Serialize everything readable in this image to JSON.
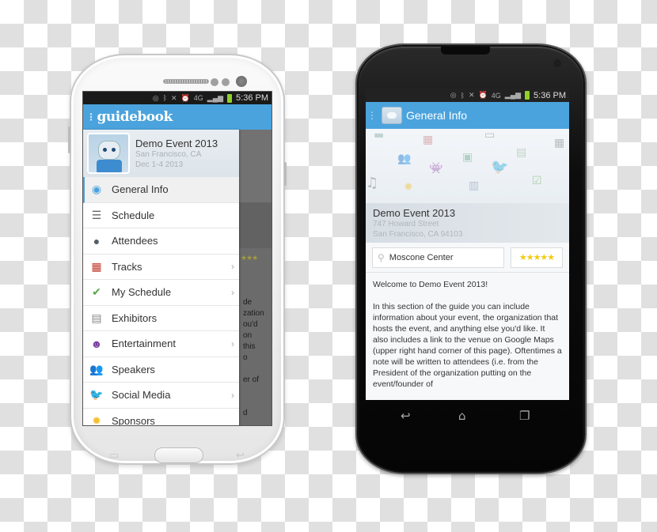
{
  "status_bar": {
    "time": "5:36 PM",
    "network": "4G"
  },
  "left_phone": {
    "app_bar": {
      "logo_text": "guidebook"
    },
    "drawer": {
      "event": {
        "title": "Demo Event 2013",
        "location": "San Francisco, CA",
        "dates": "Dec 1-4 2013"
      },
      "items": [
        {
          "label": "General Info",
          "icon": "eye-icon",
          "glyph": "◉",
          "color": "#4ba3dd",
          "chevron": false,
          "active": true
        },
        {
          "label": "Schedule",
          "icon": "schedule-list-icon",
          "glyph": "☰",
          "color": "#666666",
          "chevron": false,
          "active": false
        },
        {
          "label": "Attendees",
          "icon": "attendees-icon",
          "glyph": "●",
          "color": "#555e66",
          "chevron": false,
          "active": false
        },
        {
          "label": "Tracks",
          "icon": "calendar-icon",
          "glyph": "▦",
          "color": "#c0392b",
          "chevron": true,
          "active": false
        },
        {
          "label": "My Schedule",
          "icon": "my-schedule-check-icon",
          "glyph": "✔",
          "color": "#5aa84a",
          "chevron": true,
          "active": false
        },
        {
          "label": "Exhibitors",
          "icon": "exhibitors-booth-icon",
          "glyph": "▤",
          "color": "#888888",
          "chevron": false,
          "active": false
        },
        {
          "label": "Entertainment",
          "icon": "theater-masks-icon",
          "glyph": "☻",
          "color": "#7b3fa0",
          "chevron": true,
          "active": false
        },
        {
          "label": "Speakers",
          "icon": "speakers-icon",
          "glyph": "👥",
          "color": "#5b9bd5",
          "chevron": false,
          "active": false
        },
        {
          "label": "Social Media",
          "icon": "twitter-bird-icon",
          "glyph": "🐦",
          "color": "#3a9ad9",
          "chevron": true,
          "active": false
        },
        {
          "label": "Sponsors",
          "icon": "sponsors-ribbon-icon",
          "glyph": "✹",
          "color": "#f2c12e",
          "chevron": false,
          "active": false
        }
      ]
    },
    "background_text": [
      "de",
      "zation",
      "ou'd",
      "on",
      "this",
      "o",
      "",
      "er of",
      "",
      "",
      "d"
    ],
    "background_stars": "★★★"
  },
  "right_phone": {
    "app_bar": {
      "title": "General Info"
    },
    "event": {
      "title": "Demo Event 2013",
      "street": "747 Howard Street",
      "city": "San Francisco, CA 94103"
    },
    "venue_button": "Moscone Center",
    "rating": {
      "stars": 5,
      "max": 5,
      "glyphs": "★★★★★"
    },
    "body": "Welcome to Demo Event 2013!\n\nIn this section of the guide you can include information about your event, the organization that hosts the event, and anything else you'd like.  It also includes a link to the venue on Google Maps (upper right hand corner of this page).  Oftentimes a note will be written to attendees (i.e. from the President of the organization putting on the event/founder of"
  }
}
